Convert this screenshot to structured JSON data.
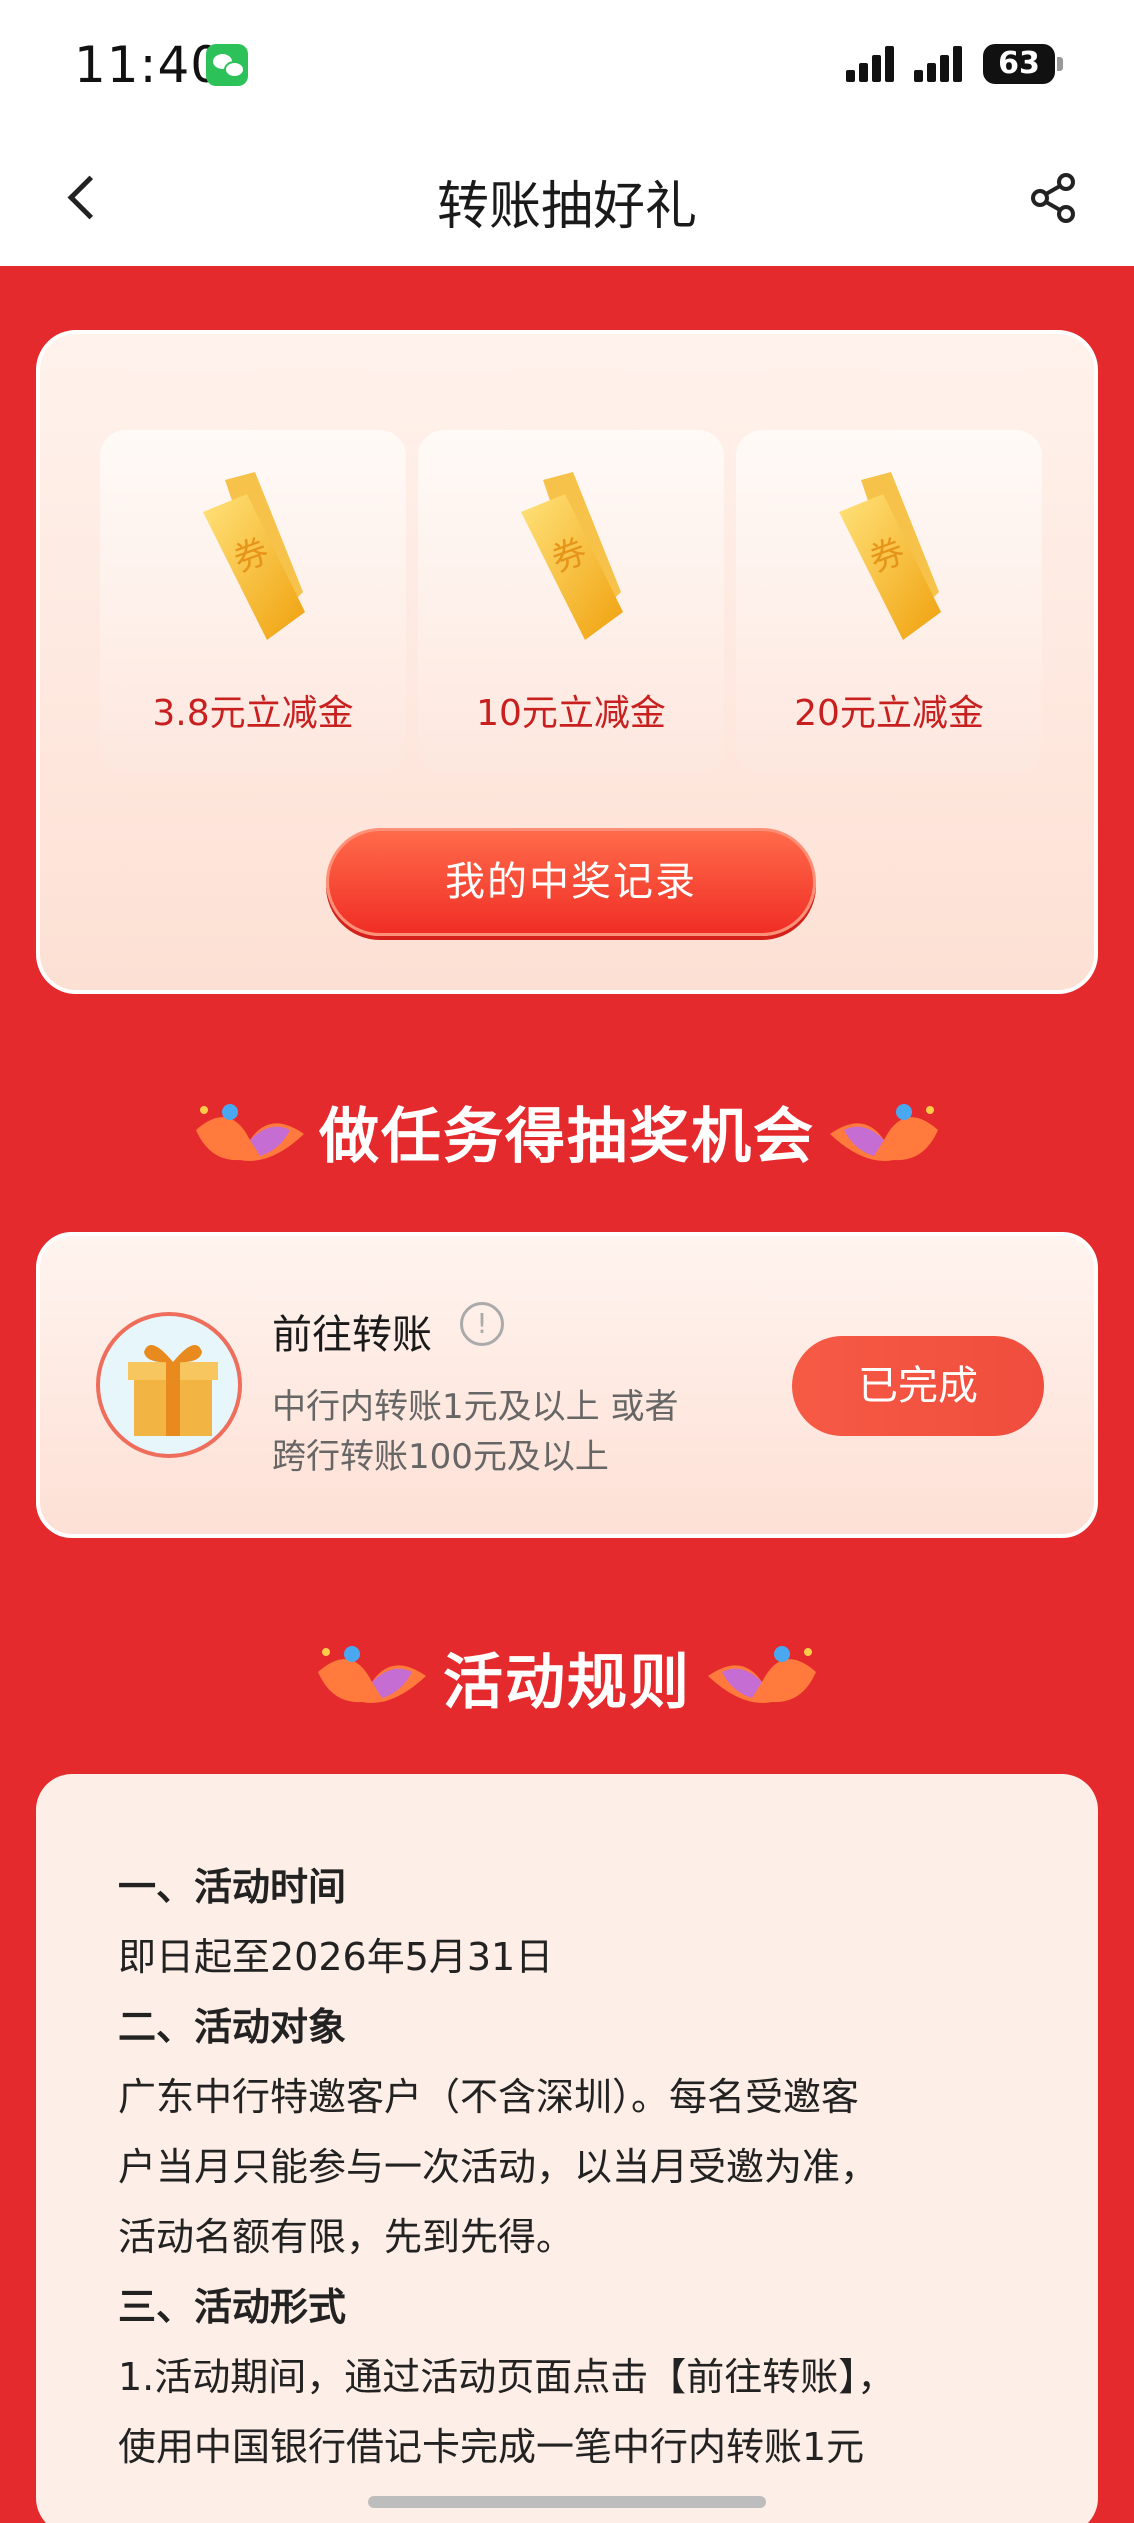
{
  "status_bar": {
    "time": "11:40",
    "battery": "63",
    "icons": [
      "wechat-icon",
      "signal-icon",
      "signal-icon",
      "battery-icon"
    ]
  },
  "nav": {
    "title": "转账抽好礼",
    "back_icon": "chevron-left-icon",
    "share_icon": "share-icon"
  },
  "prizes": {
    "items": [
      {
        "label": "3.8元立减金",
        "icon": "voucher-icon",
        "icon_text": "券"
      },
      {
        "label": "10元立减金",
        "icon": "voucher-icon",
        "icon_text": "券"
      },
      {
        "label": "20元立减金",
        "icon": "voucher-icon",
        "icon_text": "券"
      }
    ],
    "record_button": "我的中奖记录"
  },
  "tasks": {
    "section_title": "做任务得抽奖机会",
    "task": {
      "title": "前往转账",
      "info_icon": "!",
      "desc_line1": "中行内转账1元及以上 或者",
      "desc_line2": "跨行转账100元及以上",
      "button": "已完成"
    }
  },
  "rules": {
    "section_title": "活动规则",
    "lines": [
      {
        "text": "一、活动时间",
        "heading": true
      },
      {
        "text": "即日起至2026年5月31日",
        "heading": false
      },
      {
        "text": "二、活动对象",
        "heading": true
      },
      {
        "text": "广东中行特邀客户（不含深圳）。每名受邀客",
        "heading": false
      },
      {
        "text": "户当月只能参与一次活动，以当月受邀为准，",
        "heading": false
      },
      {
        "text": "活动名额有限，先到先得。",
        "heading": false
      },
      {
        "text": "三、活动形式",
        "heading": true
      },
      {
        "text": "1.活动期间，通过活动页面点击【前往转账】，",
        "heading": false
      },
      {
        "text": "使用中国银行借记卡完成一笔中行内转账1元",
        "heading": false
      }
    ]
  },
  "colors": {
    "page_bg": "#e42a2c",
    "accent_red": "#f02e26",
    "prize_text": "#c81f1f",
    "card_bg": "#fdeee7"
  }
}
